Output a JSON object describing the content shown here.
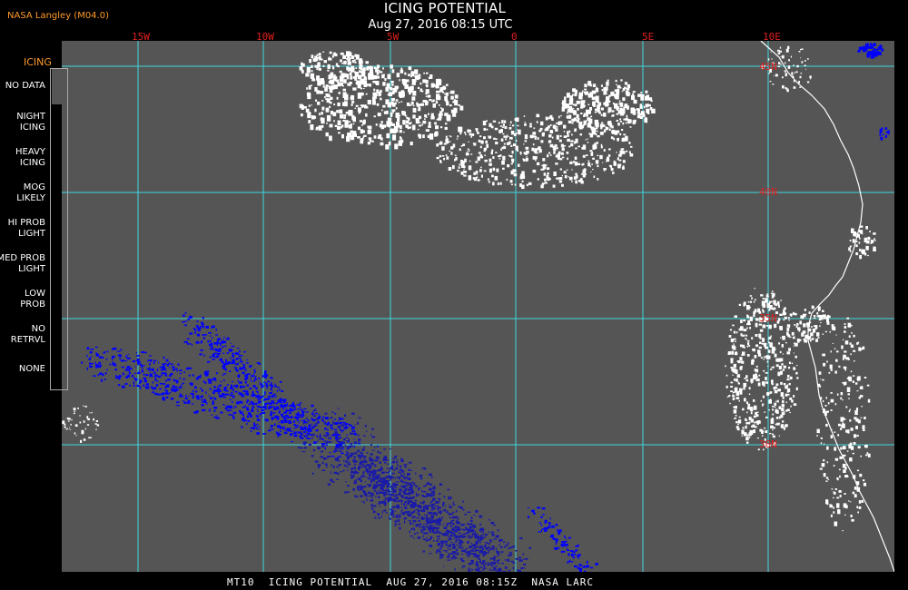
{
  "header": {
    "provider": "NASA Langley (M04.0)",
    "title": "ICING POTENTIAL",
    "subtitle": "Aug 27, 2016 08:15 UTC"
  },
  "map": {
    "longitude_labels": [
      "15W",
      "10W",
      "5W",
      "0",
      "5E",
      "10E"
    ],
    "latitude_labels": [
      "45N",
      "40N",
      "35N",
      "30N"
    ],
    "colors": {
      "background": "#555555",
      "grid": "#3fd9e0",
      "coastline": "#ffffff",
      "low_prob": "#1a1aa8",
      "med_prob": "#0000ff",
      "no_retrvl": "#ffffff"
    }
  },
  "legend": {
    "title": "ICING",
    "items": [
      {
        "label": "NO DATA",
        "color": "#00b000"
      },
      {
        "label": "NIGHT\nICING",
        "color": "#00e8e8"
      },
      {
        "label": "HEAVY\nICING",
        "color": "#e8a8e0"
      },
      {
        "label": "MOG\nLIKELY",
        "color": "#ff0000"
      },
      {
        "label": "HI PROB\nLIGHT",
        "color": "#ffff00"
      },
      {
        "label": "MED PROB\nLIGHT",
        "color": "#0000ff"
      },
      {
        "label": "LOW\nPROB",
        "color": "#000080"
      },
      {
        "label": "NO\nRETRVL",
        "color": "#ffffff"
      },
      {
        "label": "NONE",
        "color": "#555555"
      }
    ]
  },
  "footer": "MT10  ICING POTENTIAL  AUG 27, 2016 08:15Z  NASA LARC"
}
